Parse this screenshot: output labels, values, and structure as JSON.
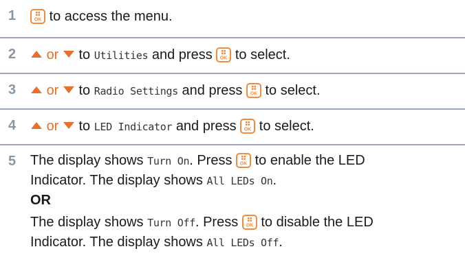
{
  "colors": {
    "accent": "#f08a3c",
    "step_number": "#8a96a8",
    "divider": "#9aa7b8"
  },
  "icons": {
    "ok_key": "ok-menu-key-icon",
    "up": "up-arrow-icon",
    "down": "down-arrow-icon"
  },
  "steps": [
    {
      "number": "1",
      "t1": "to access the menu."
    },
    {
      "number": "2",
      "or": "or",
      "to": "to",
      "item": "Utilities",
      "and_press": "and press",
      "to_select": "to select."
    },
    {
      "number": "3",
      "or": "or",
      "to": "to",
      "item": "Radio Settings",
      "and_press": "and press",
      "to_select": "to select."
    },
    {
      "number": "4",
      "or": "or",
      "to": "to",
      "item": "LED Indicator",
      "and_press": "and press",
      "to_select": "to select."
    },
    {
      "number": "5",
      "a1": "The display shows",
      "a_code": "Turn On",
      "a2": ". Press",
      "a3": "to enable the LED",
      "a4": "Indicator. The display shows",
      "a_code2": "All LEDs On",
      "a5": ".",
      "or_label": "OR",
      "b1": "The display shows",
      "b_code": "Turn Off",
      "b2": ". Press",
      "b3": "to disable the LED",
      "b4": "Indicator. The display shows",
      "b_code2": "All LEDs Off",
      "b5": "."
    }
  ],
  "ok_key_text": "OK"
}
